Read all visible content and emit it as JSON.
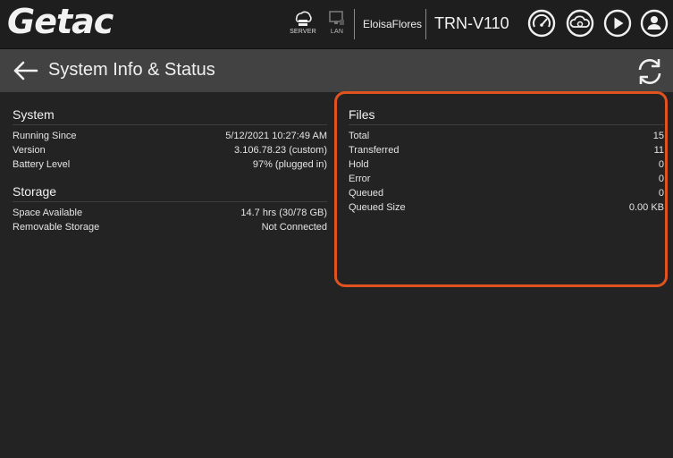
{
  "header": {
    "brand": "Getac",
    "server_label": "SERVER",
    "lan_label": "LAN",
    "user": "EloisaFlores",
    "device": "TRN-V110",
    "icons": [
      "gauge-icon",
      "cloud-upload-icon",
      "play-icon",
      "user-icon"
    ]
  },
  "titlebar": {
    "title": "System Info & Status"
  },
  "system": {
    "heading": "System",
    "rows": [
      {
        "label": "Running Since",
        "value": "5/12/2021 10:27:49 AM"
      },
      {
        "label": "Version",
        "value": "3.106.78.23 (custom)"
      },
      {
        "label": "Battery Level",
        "value": "97% (plugged in)"
      }
    ]
  },
  "storage": {
    "heading": "Storage",
    "rows": [
      {
        "label": "Space Available",
        "value": "14.7 hrs (30/78 GB)"
      },
      {
        "label": "Removable Storage",
        "value": "Not Connected"
      }
    ]
  },
  "files": {
    "heading": "Files",
    "rows": [
      {
        "label": "Total",
        "value": "15"
      },
      {
        "label": "Transferred",
        "value": "11"
      },
      {
        "label": "Hold",
        "value": "0"
      },
      {
        "label": "Error",
        "value": "0"
      },
      {
        "label": "Queued",
        "value": "0"
      },
      {
        "label": "Queued Size",
        "value": "0.00 KB"
      }
    ]
  },
  "colors": {
    "highlight": "#e0521e",
    "background": "#232323",
    "titlebar": "#424242"
  }
}
